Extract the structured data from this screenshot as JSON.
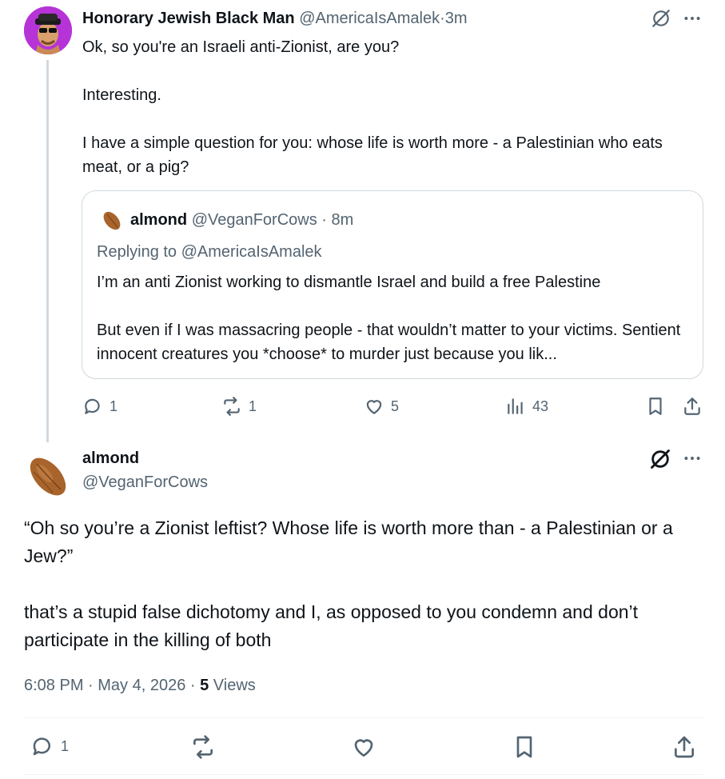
{
  "reply_tweet": {
    "author_name": "Honorary Jewish Black Man",
    "author_handle": "@AmericaIsAmalek",
    "time_sep": "·",
    "time": "3m",
    "text": "Ok, so you're an Israeli anti-Zionist, are you?\n\nInteresting.\n\nI have a simple question for you: whose life is worth more - a Palestinian who eats meat, or a pig?",
    "quoted": {
      "author_name": "almond",
      "author_handle": "@VeganForCows",
      "time_sep": "·",
      "time": "8m",
      "replying_prefix": "Replying to",
      "replying_to": "@AmericaIsAmalek",
      "text": "I’m an anti Zionist working to dismantle Israel and build a free Palestine\n\nBut even if I was massacring people - that wouldn’t matter to your victims. Sentient innocent creatures you *choose* to murder just because you lik..."
    },
    "actions": {
      "replies": "1",
      "reposts": "1",
      "likes": "5",
      "views": "43"
    }
  },
  "main_tweet": {
    "author_name": "almond",
    "author_handle": "@VeganForCows",
    "text": "“Oh so you’re a Zionist leftist? Whose life is worth more than - a Palestinian or a Jew?”\n\nthat’s a stupid false dichotomy and I, as opposed to you condemn and don’t participate in the killing of both",
    "timestamp": "6:08 PM · May 4, 2026 ·",
    "views_count": "5",
    "views_label": "Views",
    "actions": {
      "replies": "1"
    }
  },
  "icons": {
    "more": "more-horizontal-icon",
    "grok": "slashed-circle-icon",
    "reply": "reply-bubble-icon",
    "repost": "repost-icon",
    "like": "heart-icon",
    "views": "bar-chart-icon",
    "bookmark": "bookmark-icon",
    "share": "share-icon"
  },
  "colors": {
    "text": "#0f1419",
    "muted": "#536471",
    "border": "#cfd9de",
    "avatar_bg": "#b633d8"
  }
}
